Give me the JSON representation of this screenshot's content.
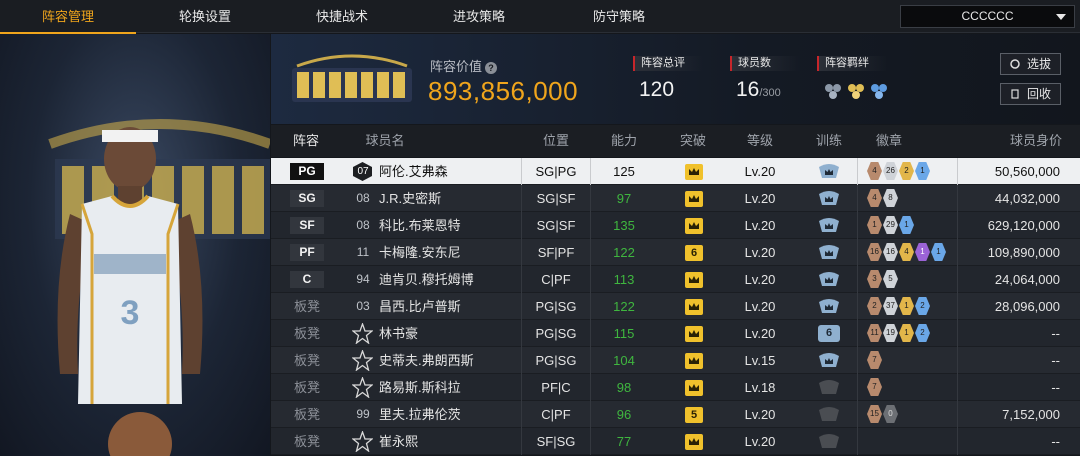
{
  "tabs": [
    {
      "label": "阵容管理",
      "active": true
    },
    {
      "label": "轮换设置",
      "active": false
    },
    {
      "label": "快捷战术",
      "active": false
    },
    {
      "label": "进攻策略",
      "active": false
    },
    {
      "label": "防守策略",
      "active": false
    }
  ],
  "team_select": {
    "value": "CCCCCC"
  },
  "header": {
    "value_label": "阵容价值",
    "value": "893,856,000",
    "overall_label": "阵容总评",
    "overall": "120",
    "players_label": "球员数",
    "players": "16",
    "players_max": "/300",
    "chemistry_label": "阵容羁绊",
    "select_btn": "选拔",
    "recycle_btn": "回收"
  },
  "columns": [
    "阵容",
    "球员名",
    "位置",
    "能力",
    "突破",
    "等级",
    "训练",
    "徽章",
    "球员身价"
  ],
  "colors": {
    "accent": "#f0a51c",
    "ability_green": "#3fb63f"
  },
  "rows": [
    {
      "slot": "PG",
      "num": "07",
      "name": "阿伦.艾弗森",
      "pos": "SG|PG",
      "ability": "125",
      "breakthrough": "crown",
      "level": "Lv.20",
      "training": "crown-blue",
      "badges": [
        [
          "bronze",
          "4"
        ],
        [
          "silver",
          "26"
        ],
        [
          "gold",
          "2"
        ],
        [
          "blue",
          "1"
        ]
      ],
      "salary": "50,560,000"
    },
    {
      "slot": "SG",
      "num": "08",
      "name": "J.R.史密斯",
      "pos": "SG|SF",
      "ability": "97",
      "breakthrough": "crown",
      "level": "Lv.20",
      "training": "crown-blue",
      "badges": [
        [
          "bronze",
          "4"
        ],
        [
          "silver",
          "8"
        ]
      ],
      "salary": "44,032,000"
    },
    {
      "slot": "SF",
      "num": "08",
      "name": "科比.布莱恩特",
      "pos": "SG|SF",
      "ability": "135",
      "breakthrough": "crown",
      "level": "Lv.20",
      "training": "crown-blue",
      "badges": [
        [
          "bronze",
          "1"
        ],
        [
          "silver",
          "29"
        ],
        [
          "blue",
          "1"
        ]
      ],
      "salary": "629,120,000"
    },
    {
      "slot": "PF",
      "num": "11",
      "name": "卡梅隆.安东尼",
      "pos": "SF|PF",
      "ability": "122",
      "breakthrough": "6",
      "level": "Lv.20",
      "training": "crown-blue",
      "badges": [
        [
          "bronze",
          "16"
        ],
        [
          "silver",
          "16"
        ],
        [
          "gold",
          "4"
        ],
        [
          "purple",
          "1"
        ],
        [
          "blue",
          "1"
        ]
      ],
      "salary": "109,890,000"
    },
    {
      "slot": "C",
      "num": "94",
      "name": "迪肯贝.穆托姆博",
      "pos": "C|PF",
      "ability": "113",
      "breakthrough": "crown",
      "level": "Lv.20",
      "training": "crown-blue",
      "badges": [
        [
          "bronze",
          "3"
        ],
        [
          "silver",
          "5"
        ]
      ],
      "salary": "24,064,000"
    },
    {
      "slot": "板凳",
      "num": "03",
      "name": "昌西.比卢普斯",
      "pos": "PG|SG",
      "ability": "122",
      "breakthrough": "crown",
      "level": "Lv.20",
      "training": "crown-blue",
      "badges": [
        [
          "bronze",
          "2"
        ],
        [
          "silver",
          "37"
        ],
        [
          "gold",
          "1"
        ],
        [
          "blue",
          "2"
        ]
      ],
      "salary": "28,096,000"
    },
    {
      "slot": "板凳",
      "num": "",
      "name": "林书豪",
      "pos": "PG|SG",
      "ability": "115",
      "breakthrough": "crown",
      "level": "Lv.20",
      "training": "6",
      "badges": [
        [
          "bronze",
          "11"
        ],
        [
          "silver",
          "19"
        ],
        [
          "gold",
          "1"
        ],
        [
          "blue",
          "2"
        ]
      ],
      "salary": "--"
    },
    {
      "slot": "板凳",
      "num": "",
      "name": "史蒂夫.弗朗西斯",
      "pos": "PG|SG",
      "ability": "104",
      "breakthrough": "crown",
      "level": "Lv.15",
      "training": "crown-blue",
      "badges": [
        [
          "bronze",
          "7"
        ]
      ],
      "salary": "--"
    },
    {
      "slot": "板凳",
      "num": "",
      "name": "路易斯.斯科拉",
      "pos": "PF|C",
      "ability": "98",
      "breakthrough": "crown",
      "level": "Lv.18",
      "training": "crown-grey",
      "badges": [
        [
          "bronze",
          "7"
        ]
      ],
      "salary": "--"
    },
    {
      "slot": "板凳",
      "num": "99",
      "name": "里夫.拉弗伦茨",
      "pos": "C|PF",
      "ability": "96",
      "breakthrough": "5",
      "level": "Lv.20",
      "training": "crown-grey",
      "badges": [
        [
          "bronze",
          "15"
        ],
        [
          "grey",
          "0"
        ]
      ],
      "salary": "7,152,000"
    },
    {
      "slot": "板凳",
      "num": "",
      "name": "崔永熙",
      "pos": "SF|SG",
      "ability": "77",
      "breakthrough": "crown",
      "level": "Lv.20",
      "training": "crown-grey",
      "badges": [],
      "salary": "--"
    }
  ]
}
